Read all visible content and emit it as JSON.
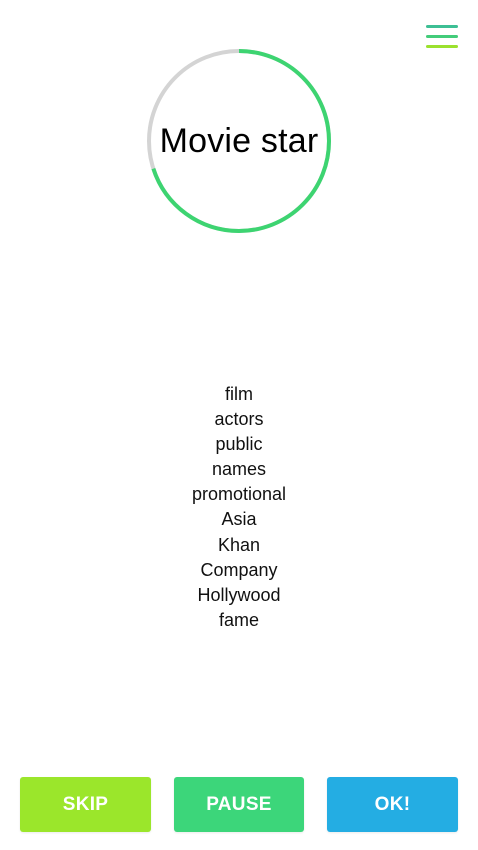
{
  "menu": {
    "icon": "hamburger-menu-icon",
    "colors": [
      "#3dbf94",
      "#43cc7a",
      "#9be12e"
    ]
  },
  "timer": {
    "word": "Movie star",
    "progress_remaining": 0.7,
    "colors": {
      "track": "#d4d4d4",
      "progress": "#3dd471"
    }
  },
  "hints": [
    "film",
    "actors",
    "public",
    "names",
    "promotional",
    "Asia",
    "Khan",
    "Company",
    "Hollywood",
    "fame"
  ],
  "buttons": {
    "skip": {
      "label": "SKIP",
      "color": "#9be62b"
    },
    "pause": {
      "label": "PAUSE",
      "color": "#3cd67a"
    },
    "ok": {
      "label": "OK!",
      "color": "#24ade3"
    }
  }
}
